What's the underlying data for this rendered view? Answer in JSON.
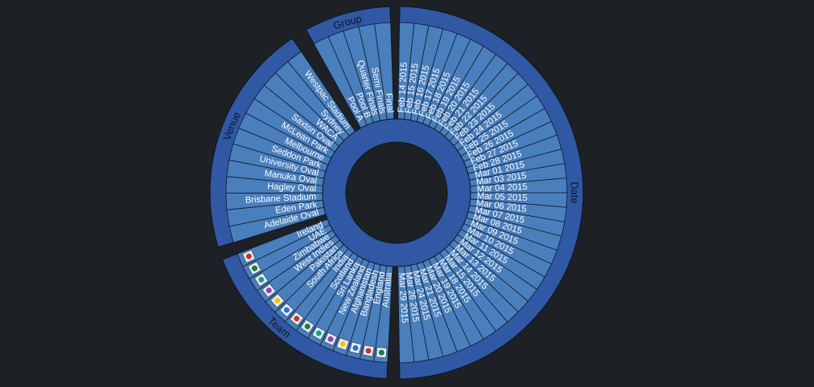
{
  "categories": [
    {
      "title": "Date",
      "items": [
        "Feb 14 2015",
        "Feb 15 2015",
        "Feb 16 2015",
        "Feb 17 2015",
        "Feb 18 2015",
        "Feb 19 2015",
        "Feb 20 2015",
        "Feb 21 2015",
        "Feb 22 2015",
        "Feb 23 2015",
        "Feb 24 2015",
        "Feb 25 2015",
        "Feb 26 2015",
        "Feb 27 2015",
        "Feb 28 2015",
        "Mar 01 2015",
        "Mar 03 2015",
        "Mar 04 2015",
        "Mar 05 2015",
        "Mar 06 2015",
        "Mar 07 2015",
        "Mar 08 2015",
        "Mar 09 2015",
        "Mar 10 2015",
        "Mar 11 2015",
        "Mar 12 2015",
        "Mar 13 2015",
        "Mar 14 2015",
        "Mar 15 2015",
        "Mar 18 2015",
        "Mar 19 2015",
        "Mar 20 2015",
        "Mar 21 2015",
        "Mar 24 2015",
        "Mar 26 2015",
        "Mar 29 2015"
      ]
    },
    {
      "title": "Team",
      "items": [
        "Australia",
        "England",
        "Bangladesh",
        "Afghanistan",
        "New Zealand",
        "Sri Lanka",
        "Scotland",
        "India",
        "South Africa",
        "Pakistan",
        "West Indies",
        "Zimbabwe",
        "UAE",
        "Ireland"
      ],
      "flag_icons": [
        "flag-australia-icon",
        "flag-england-icon",
        "flag-bangladesh-icon",
        "flag-afghanistan-icon",
        "flag-new-zealand-icon",
        "flag-sri-lanka-icon",
        "flag-scotland-icon",
        "flag-india-icon",
        "flag-south-africa-icon",
        "flag-pakistan-icon",
        "flag-west-indies-icon",
        "flag-zimbabwe-icon",
        "flag-uae-icon",
        "flag-ireland-icon"
      ]
    },
    {
      "title": "Venue",
      "items": [
        "Adelaide Oval",
        "Eden Park",
        "Brisbane Stadium",
        "Hagley Oval",
        "Manuka Oval",
        "University Oval",
        "Seddon Park",
        "Melbourne",
        "McLean Park",
        "Saxton Oval",
        "WACA",
        "Sydney",
        "Westpac Stadium"
      ]
    },
    {
      "title": "Group",
      "items": [
        "Pool A",
        "Pool B",
        "Quarter Finals",
        "Semi Finals",
        "Final"
      ]
    }
  ],
  "colors": {
    "background": "#1d2126",
    "band": "#3058a4",
    "sector": "#4a7fbd",
    "text": "#ffffff",
    "title_text": "#0e1726"
  }
}
